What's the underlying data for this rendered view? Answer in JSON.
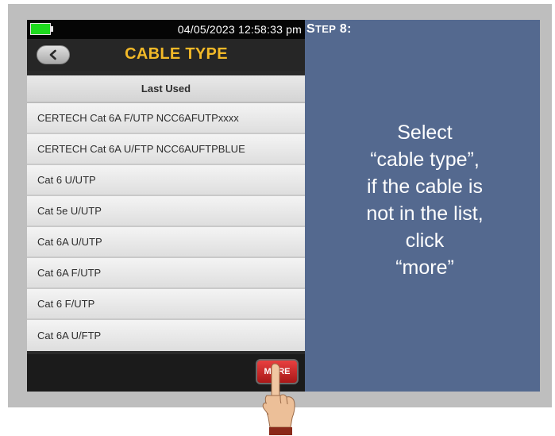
{
  "device": {
    "status": {
      "datetime": "04/05/2023 12:58:33 pm"
    },
    "title": "CABLE TYPE",
    "list": {
      "header": "Last Used",
      "items": [
        "CERTECH Cat 6A F/UTP NCC6AFUTPxxxx",
        "CERTECH Cat 6A U/FTP NCC6AUFTPBLUE",
        "Cat 6 U/UTP",
        "Cat 5e U/UTP",
        "Cat 6A U/UTP",
        "Cat 6A F/UTP",
        "Cat 6 F/UTP",
        "Cat 6A U/FTP"
      ]
    },
    "more_label": "MORE"
  },
  "panel": {
    "step_word_first": "S",
    "step_word_rest": "TEP",
    "step_number": "8:",
    "instruction_lines": [
      "Select",
      "“cable type”,",
      "if the cable is",
      "not in the list,",
      "click",
      "“more”"
    ]
  },
  "colors": {
    "battery": "#1ed81e",
    "title_accent": "#f2b928",
    "panel_bg": "#54698f",
    "more_button": "#d02828"
  },
  "icons": [
    "battery-icon",
    "back-arrow-icon",
    "pointing-hand-icon"
  ]
}
